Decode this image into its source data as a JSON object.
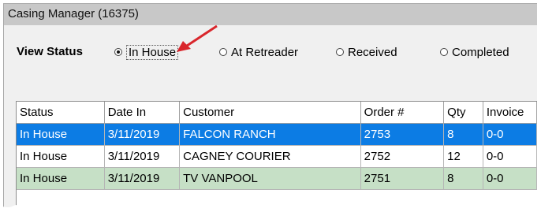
{
  "window": {
    "title": "Casing Manager (16375)"
  },
  "view_status": {
    "label": "View Status",
    "options": [
      {
        "label": "In House",
        "selected": true
      },
      {
        "label": "At Retreader",
        "selected": false
      },
      {
        "label": "Received",
        "selected": false
      },
      {
        "label": "Completed",
        "selected": false
      }
    ]
  },
  "grid": {
    "columns": [
      "Status",
      "Date In",
      "Customer",
      "Order #",
      "Qty",
      "Invoice"
    ],
    "rows": [
      {
        "status": "In House",
        "date_in": "3/11/2019",
        "customer": "FALCON RANCH",
        "order": "2753",
        "qty": "8",
        "invoice": "0-0"
      },
      {
        "status": "In House",
        "date_in": "3/11/2019",
        "customer": "CAGNEY COURIER",
        "order": "2752",
        "qty": "12",
        "invoice": "0-0"
      },
      {
        "status": "In House",
        "date_in": "3/11/2019",
        "customer": "TV VANPOOL",
        "order": "2751",
        "qty": "8",
        "invoice": "0-0"
      }
    ]
  },
  "colors": {
    "selected_row": "#0c7ce4",
    "green_row": "#c6e0c6",
    "annotation_arrow": "#d9262c"
  }
}
